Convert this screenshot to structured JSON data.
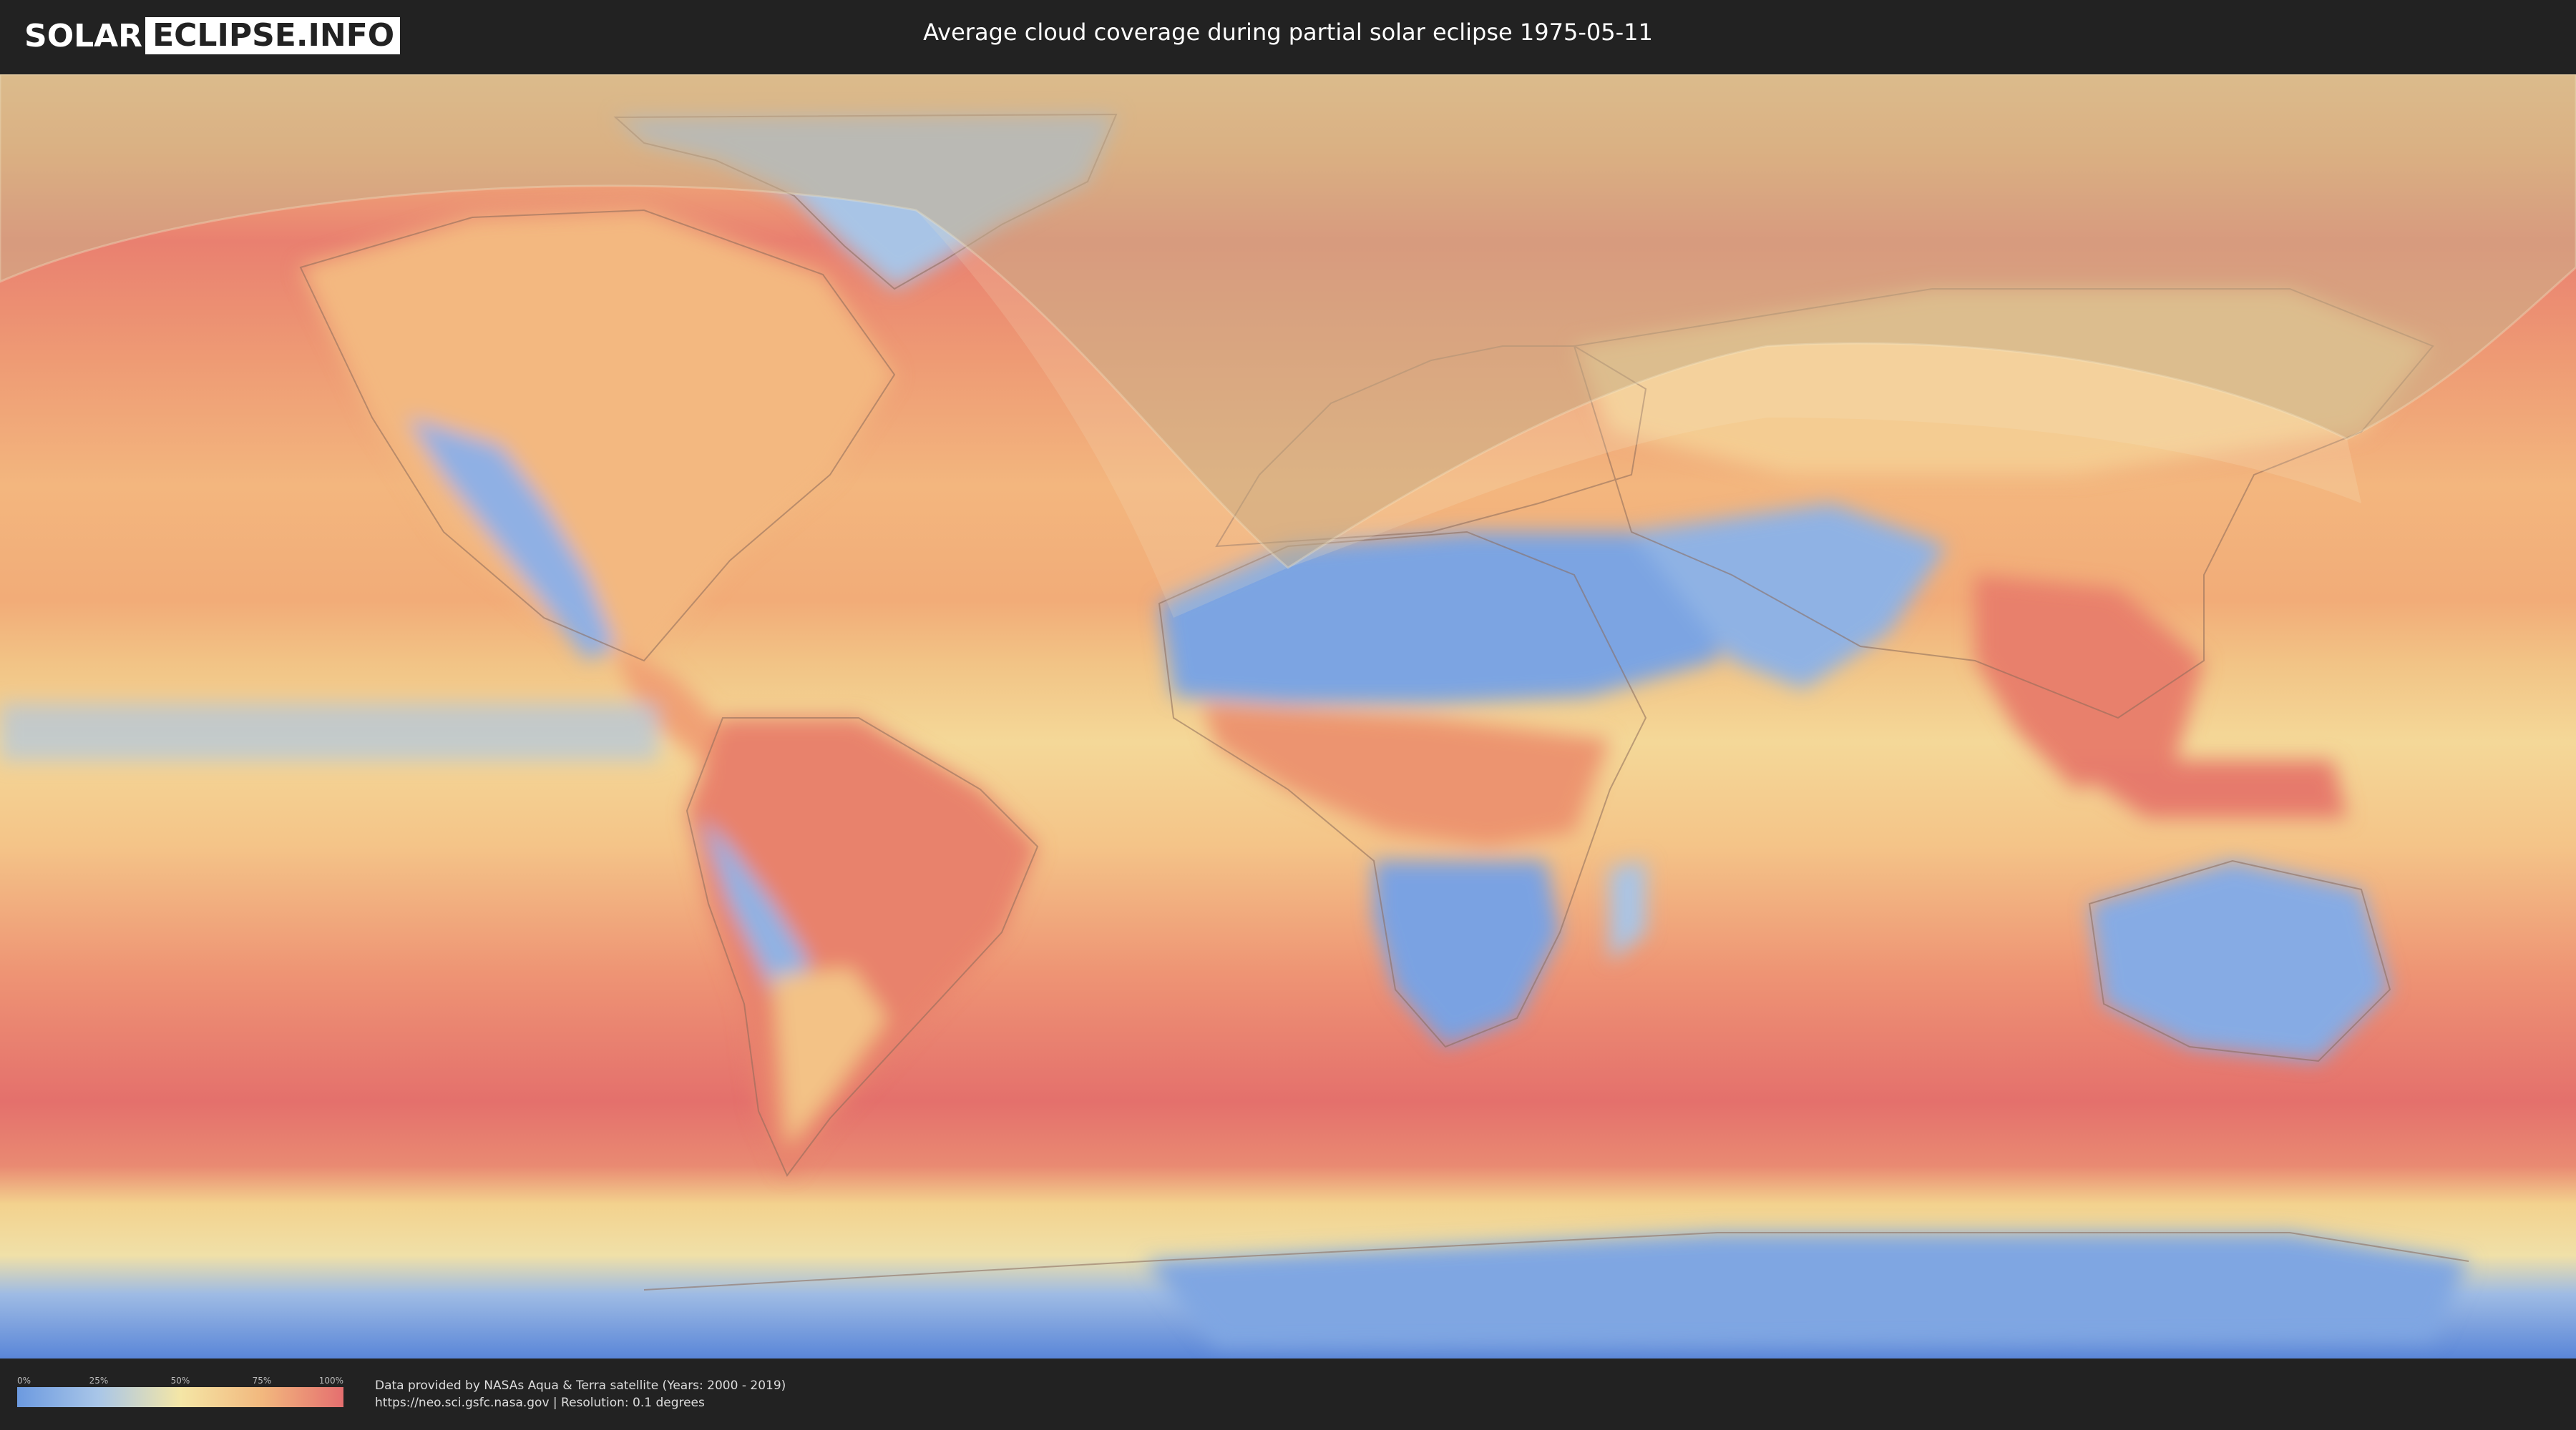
{
  "header": {
    "logo_part1": "SOLAR",
    "logo_part2": "ECLIPSE.INFO",
    "title": "Average cloud coverage during partial solar eclipse 1975-05-11"
  },
  "legend": {
    "ticks": [
      "0%",
      "25%",
      "50%",
      "75%",
      "100%"
    ],
    "tick_values": [
      0,
      25,
      50,
      75,
      100
    ],
    "colors": [
      "#6c9ae0",
      "#a9c6e8",
      "#f4e6a6",
      "#f2b87e",
      "#e56f6f"
    ]
  },
  "footer": {
    "line1": "Data provided by NASAs Aqua & Terra satellite (Years: 2000 - 2019)",
    "line2": "https://neo.sci.gsfc.nasa.gov | Resolution: 0.1 degrees"
  },
  "colors": {
    "background": "#222222",
    "cloud_high": "#e56f6f",
    "cloud_mid": "#f4e6a6",
    "cloud_low": "#6c9ae0",
    "eclipse_overlay": "#c8b08a"
  }
}
